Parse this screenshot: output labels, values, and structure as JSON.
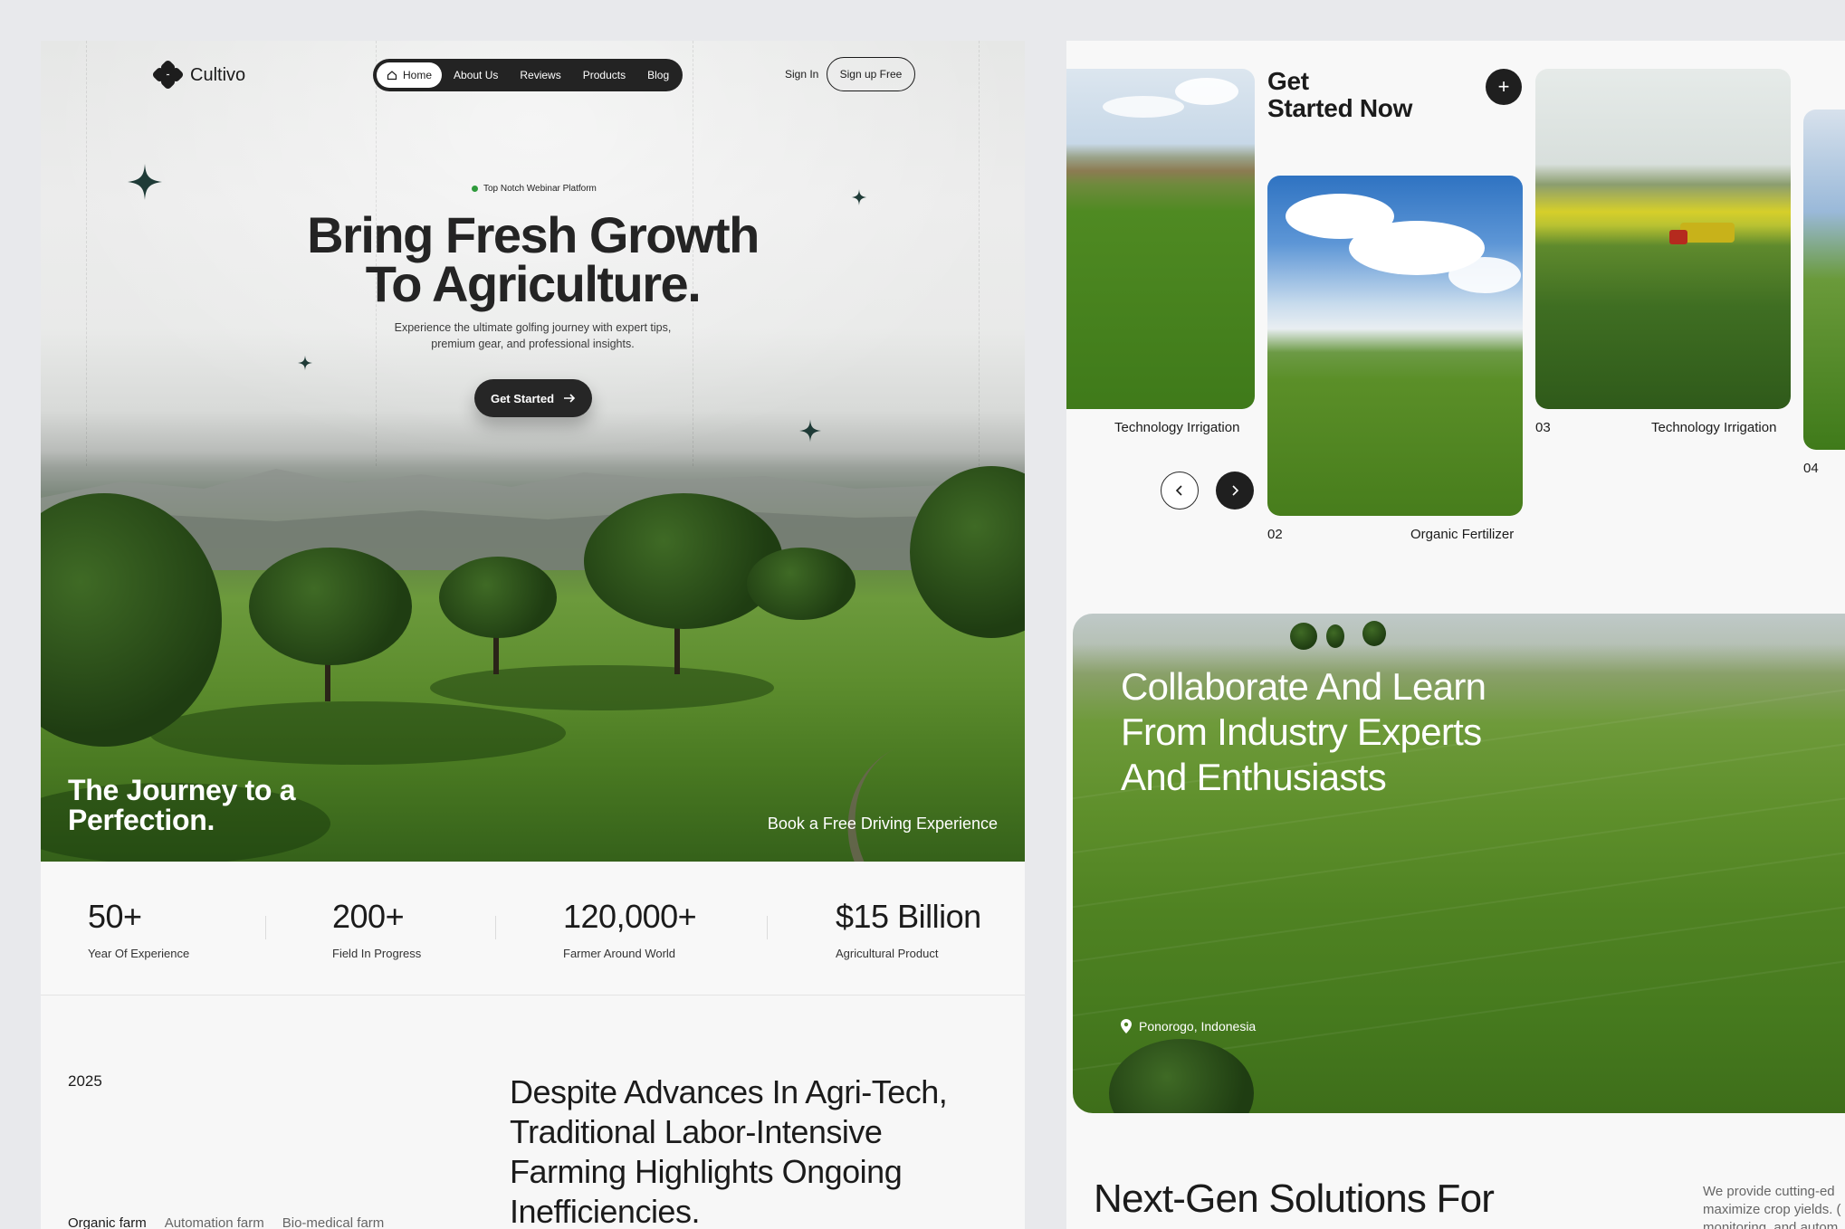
{
  "brand": {
    "name": "Cultivo"
  },
  "nav": {
    "items": [
      {
        "label": "Home",
        "icon": "home-icon",
        "active": true
      },
      {
        "label": "About Us"
      },
      {
        "label": "Reviews"
      },
      {
        "label": "Products"
      },
      {
        "label": "Blog"
      }
    ],
    "sign_in": "Sign In",
    "sign_up": "Sign up Free"
  },
  "hero": {
    "badge": "Top Notch Webinar Platform",
    "title_line1": "Bring Fresh Growth",
    "title_line2": "To Agriculture.",
    "sub_line1": "Experience the ultimate golfing journey with expert tips,",
    "sub_line2": "premium gear, and professional insights.",
    "cta": "Get Started",
    "journey_line1": "The Journey to a",
    "journey_line2": "Perfection.",
    "book": "Book a Free Driving Experience"
  },
  "stats": [
    {
      "value": "50+",
      "label": "Year Of Experience"
    },
    {
      "value": "200+",
      "label": "Field In Progress"
    },
    {
      "value": "120,000+",
      "label": "Farmer Around World"
    },
    {
      "value": "$15 Billion",
      "label": "Agricultural Product"
    }
  ],
  "about": {
    "year": "2025",
    "desc_line1": "Despite Advances In Agri-Tech,",
    "desc_line2": "Traditional Labor-Intensive",
    "desc_line3": "Farming Highlights Ongoing",
    "desc_line4": "Inefficiencies.",
    "tabs": [
      "Organic farm",
      "Automation farm",
      "Bio-medical farm"
    ]
  },
  "get_started": {
    "title_line1": "Get",
    "title_line2": "Started Now",
    "cards": [
      {
        "caption": "Technology Irrigation"
      },
      {
        "number": "02",
        "caption": "Organic Fertilizer"
      },
      {
        "number": "03",
        "caption": "Technology Irrigation"
      },
      {
        "number": "04"
      }
    ]
  },
  "collab": {
    "line1": "Collaborate And Learn",
    "line2": "From Industry Experts",
    "line3": "And Enthusiasts",
    "location": "Ponorogo, Indonesia"
  },
  "next_gen": {
    "title": "Next-Gen Solutions For",
    "side_line1": "We provide cutting-ed",
    "side_line2": "maximize crop yields. (",
    "side_line3": "monitoring, and autom"
  }
}
